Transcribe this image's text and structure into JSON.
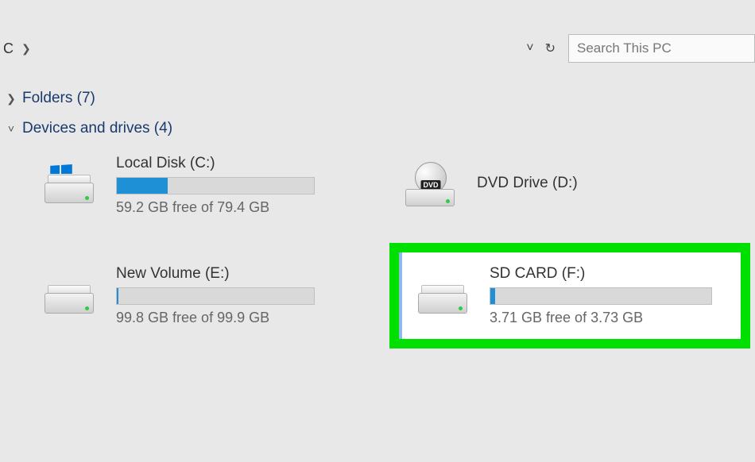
{
  "addressBar": {
    "breadcrumb": "C",
    "searchPlaceholder": "Search This PC"
  },
  "groups": {
    "folders": {
      "label": "Folders (7)"
    },
    "drives": {
      "label": "Devices and drives (4)"
    }
  },
  "drives": {
    "localDisk": {
      "name": "Local Disk (C:)",
      "freeText": "59.2 GB free of 79.4 GB",
      "usedPct": 26
    },
    "dvd": {
      "name": "DVD Drive (D:)"
    },
    "newVolume": {
      "name": "New Volume (E:)",
      "freeText": "99.8 GB free of 99.9 GB",
      "usedPct": 1
    },
    "sdCard": {
      "name": "SD CARD (F:)",
      "freeText": "3.71 GB free of 3.73 GB",
      "usedPct": 2
    }
  }
}
